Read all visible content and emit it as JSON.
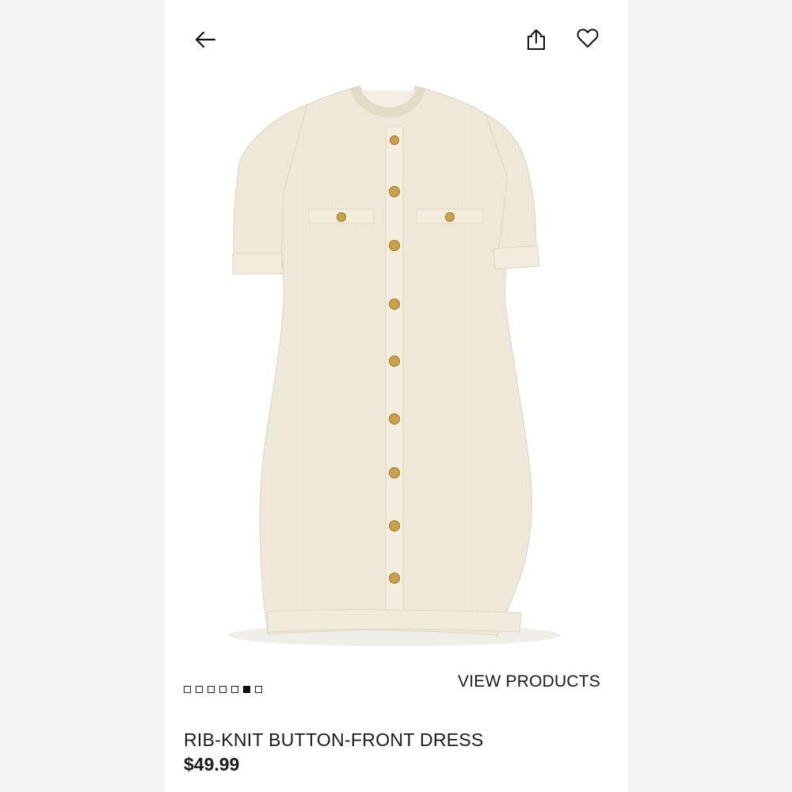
{
  "header": {
    "back_icon": "arrow-left-icon",
    "share_icon": "share-icon",
    "favorite_icon": "heart-icon"
  },
  "gallery": {
    "total_images": 7,
    "active_index": 5
  },
  "cta": {
    "view_products_label": "VIEW PRODUCTS"
  },
  "product": {
    "name": "RIB-KNIT BUTTON-FRONT DRESS",
    "price": "$49.99",
    "color_hex": "#f5f1e4",
    "button_color_hex": "#c9a24a"
  }
}
